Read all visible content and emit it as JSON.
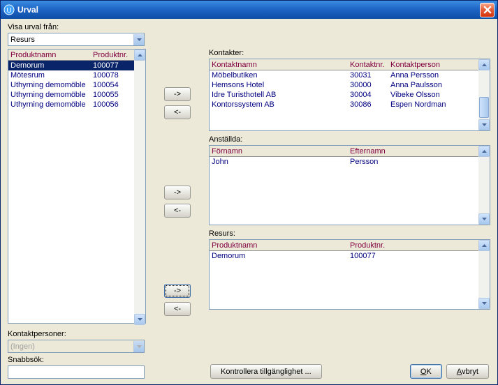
{
  "window": {
    "title": "Urval"
  },
  "labels": {
    "show_selection_from": "Visa urval från:",
    "kontakter": "Kontakter:",
    "anstallda": "Anställda:",
    "resurs": "Resurs:",
    "kontaktpersoner": "Kontaktpersoner:",
    "snabbsok": "Snabbsök:"
  },
  "dropdowns": {
    "source": {
      "value": "Resurs"
    },
    "kontaktpersoner": {
      "value": "(Ingen)"
    }
  },
  "left_table": {
    "headers": [
      "Produktnamn",
      "Produktnr."
    ],
    "rows": [
      {
        "name": "Demorum",
        "nr": "100077",
        "selected": true
      },
      {
        "name": "Mötesrum",
        "nr": "100078",
        "selected": false
      },
      {
        "name": "Uthyrning demomöble",
        "nr": "100054",
        "selected": false
      },
      {
        "name": "Uthyrning demomöble",
        "nr": "100055",
        "selected": false
      },
      {
        "name": "Uthyrning demomöble",
        "nr": "100056",
        "selected": false
      }
    ]
  },
  "kontakter_table": {
    "headers": [
      "Kontaktnamn",
      "Kontaktnr.",
      "Kontaktperson"
    ],
    "rows": [
      {
        "name": "Möbelbutiken",
        "nr": "30031",
        "person": "Anna Persson"
      },
      {
        "name": "Hemsons Hotel",
        "nr": "30000",
        "person": "Anna Paulsson"
      },
      {
        "name": "Idre Turisthotell AB",
        "nr": "30004",
        "person": "Vibeke Olsson"
      },
      {
        "name": "Kontorssystem AB",
        "nr": "30086",
        "person": "Espen Nordman"
      }
    ]
  },
  "anstallda_table": {
    "headers": [
      "Förnamn",
      "Efternamn"
    ],
    "rows": [
      {
        "first": "John",
        "last": "Persson"
      }
    ]
  },
  "resurs_table": {
    "headers": [
      "Produktnamn",
      "Produktnr."
    ],
    "rows": [
      {
        "name": "Demorum",
        "nr": "100077"
      }
    ]
  },
  "buttons": {
    "kontrollera": "Kontrollera tillgänglighet ...",
    "ok": "OK",
    "avbryt": "Avbryt",
    "right": "->",
    "left": "<-"
  }
}
